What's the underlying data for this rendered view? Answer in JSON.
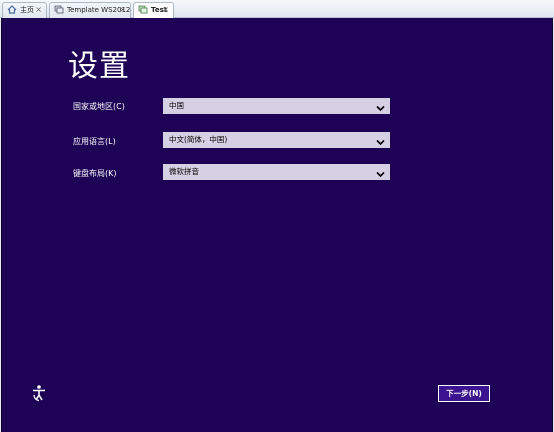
{
  "tabs": [
    {
      "label": "主页",
      "icon": "home-icon",
      "active": false
    },
    {
      "label": "Template WS2012",
      "icon": "vm-icon",
      "active": false
    },
    {
      "label": "Test",
      "icon": "vm-icon",
      "active": true
    }
  ],
  "tab_close_glyph": "×",
  "setup": {
    "title": "设置",
    "fields": [
      {
        "label": "国家或地区(C)",
        "value": "中国"
      },
      {
        "label": "应用语言(L)",
        "value": "中文(简体，中国)"
      },
      {
        "label": "键盘布局(K)",
        "value": "微软拼音"
      }
    ],
    "next_label": "下一步(N)"
  },
  "colors": {
    "background": "#1e0256",
    "select_bg": "#d6d0e4",
    "button_bg": "#3c1490"
  }
}
